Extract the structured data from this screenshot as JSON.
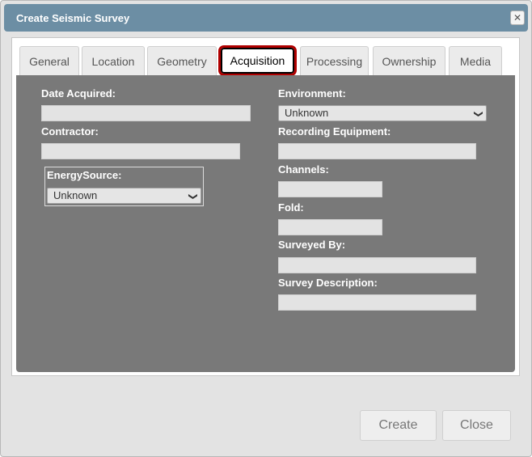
{
  "dialog": {
    "title": "Create Seismic Survey",
    "close_icon": "close-icon"
  },
  "tabs": [
    {
      "label": "General"
    },
    {
      "label": "Location"
    },
    {
      "label": "Geometry"
    },
    {
      "label": "Acquisition",
      "active": true
    },
    {
      "label": "Processing"
    },
    {
      "label": "Ownership"
    },
    {
      "label": "Media"
    }
  ],
  "form": {
    "date_acquired": {
      "label": "Date Acquired:",
      "value": ""
    },
    "contractor": {
      "label": "Contractor:",
      "value": ""
    },
    "energy_source": {
      "label": "EnergySource:",
      "value": "Unknown"
    },
    "environment": {
      "label": "Environment:",
      "value": "Unknown"
    },
    "recording_equipment": {
      "label": "Recording Equipment:",
      "value": ""
    },
    "channels": {
      "label": "Channels:",
      "value": ""
    },
    "fold": {
      "label": "Fold:",
      "value": ""
    },
    "surveyed_by": {
      "label": "Surveyed By:",
      "value": ""
    },
    "survey_description": {
      "label": "Survey Description:",
      "value": ""
    }
  },
  "buttons": {
    "create": "Create",
    "close": "Close"
  },
  "colors": {
    "titlebar": "#6c8ea4",
    "panel": "#797979",
    "active_tab_highlight": "#b00000"
  }
}
